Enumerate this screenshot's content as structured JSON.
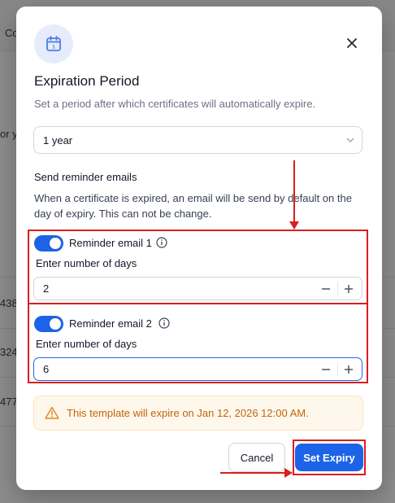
{
  "background": {
    "header_text": "Co",
    "side_text": "or y",
    "row_numbers": [
      "438",
      "324",
      "477"
    ]
  },
  "modal": {
    "icon": "calendar-icon",
    "close_icon": "close-icon",
    "title": "Expiration Period",
    "subtitle": "Set a period after which certificates will automatically expire.",
    "period_select": {
      "value": "1 year"
    },
    "reminder_section": {
      "heading": "Send reminder emails",
      "description": "When a certificate is expired, an email will be send by default on the day of expiry. This can not be change."
    },
    "reminders": [
      {
        "label": "Reminder email 1",
        "enabled": true,
        "days_label": "Enter number of days",
        "days_value": "2"
      },
      {
        "label": "Reminder email 2",
        "enabled": true,
        "days_label": "Enter number of days",
        "days_value": "6"
      }
    ],
    "alert": {
      "icon": "warning-icon",
      "text": "This template will expire on Jan 12, 2026 12:00 AM."
    },
    "buttons": {
      "cancel": "Cancel",
      "confirm": "Set Expiry"
    }
  },
  "colors": {
    "primary": "#1d63e8",
    "annotation_red": "#d91e1e",
    "warning_text": "#c2650a",
    "warning_bg": "#fef7ec"
  }
}
